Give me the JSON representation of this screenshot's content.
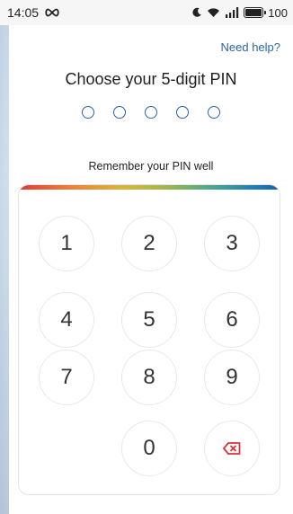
{
  "status_bar": {
    "time": "14:05",
    "infinity_icon": "infinity-icon",
    "battery_level": "100"
  },
  "header": {
    "need_help": "Need help?",
    "title": "Choose your 5-digit PIN"
  },
  "pin": {
    "length": 5,
    "entered": 0,
    "accent_color": "#2d63a8"
  },
  "hint": "Remember your PIN well",
  "keypad": {
    "keys": [
      "1",
      "2",
      "3",
      "4",
      "5",
      "6",
      "7",
      "8",
      "9",
      "0"
    ],
    "delete_icon": "backspace-icon",
    "delete_color": "#d6333b"
  }
}
